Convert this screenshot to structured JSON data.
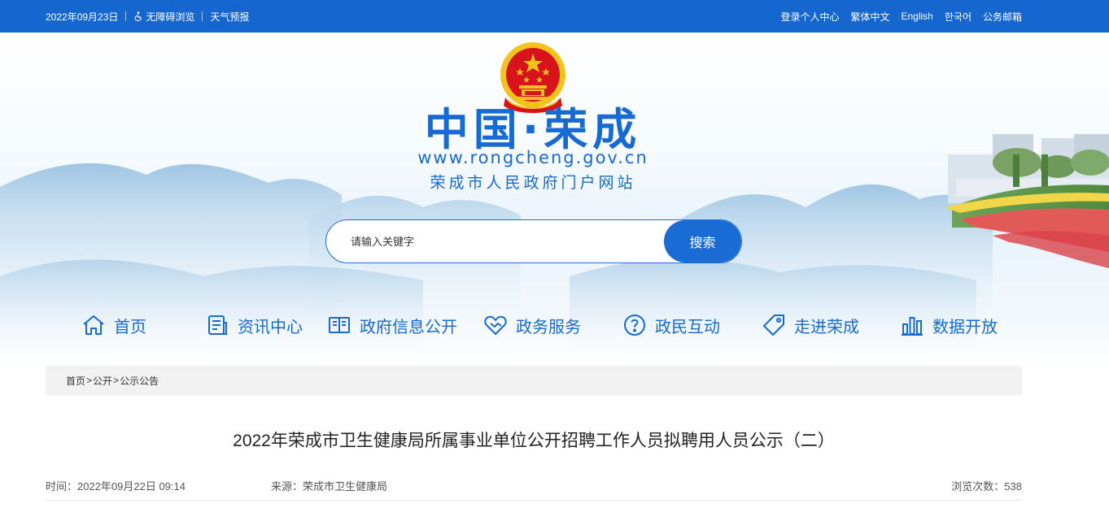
{
  "topbar": {
    "date": "2022年09月23日",
    "accessibility": "无障碍浏览",
    "weather": "天气预报",
    "links": [
      "登录个人中心",
      "繁体中文",
      "English",
      "한국어",
      "公务邮箱"
    ]
  },
  "header": {
    "title": "中国·荣成",
    "url": "www.rongcheng.gov.cn",
    "subtitle": "荣成市人民政府门户网站"
  },
  "search": {
    "placeholder": "请输入关键字",
    "button": "搜索"
  },
  "nav": {
    "items": [
      {
        "label": "首页",
        "icon": "home-icon"
      },
      {
        "label": "资讯中心",
        "icon": "document-icon"
      },
      {
        "label": "政府信息公开",
        "icon": "book-icon"
      },
      {
        "label": "政务服务",
        "icon": "handshake-icon"
      },
      {
        "label": "政民互动",
        "icon": "question-icon"
      },
      {
        "label": "走进荣成",
        "icon": "tag-icon"
      },
      {
        "label": "数据开放",
        "icon": "bar-chart-icon"
      }
    ]
  },
  "breadcrumb": {
    "items": [
      "首页",
      "公开",
      "公示公告"
    ],
    "separator": ">"
  },
  "article": {
    "title": "2022年荣成市卫生健康局所属事业单位公开招聘工作人员拟聘用人员公示（二）",
    "time": "时间：2022年09月22日 09:14",
    "source": "来源：荣成市卫生健康局",
    "views": "浏览次数：538"
  },
  "colors": {
    "brand_blue": "#1666cf",
    "title_blue": "#1769d3",
    "emblem_red": "#d7141a",
    "emblem_gold": "#f4c21c"
  }
}
